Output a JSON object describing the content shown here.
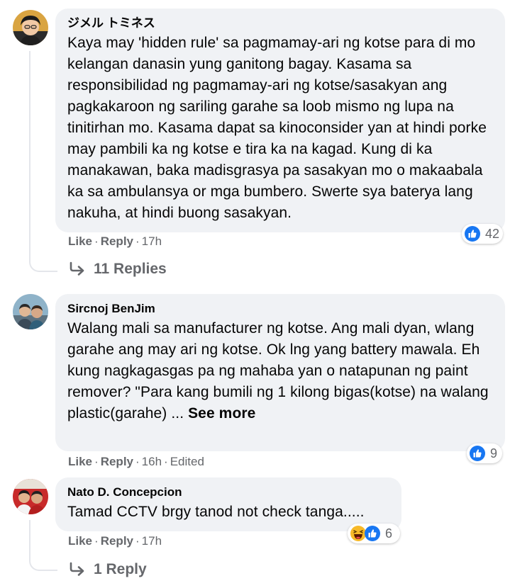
{
  "comments": [
    {
      "author": "ジメル トミネス",
      "text": "Kaya may 'hidden rule' sa pagmamay-ari ng kotse para di mo kelangan danasin yung ganitong bagay. Kasama sa responsibilidad ng pagmamay-ari ng kotse/sasakyan ang pagkakaroon ng sariling garahe sa loob mismo ng lupa na tinitirhan mo. Kasama dapat sa kinoconsider yan at hindi porke may pambili ka ng kotse e tira ka na kagad. Kung di ka manakawan, baka madisgrasya pa sasakyan mo o makaabala ka sa ambulansya or mga bumbero. Swerte sya baterya lang nakuha, at hindi buong sasakyan.",
      "like_label": "Like",
      "reply_label": "Reply",
      "time": "17h",
      "reaction_count": "42",
      "reaction_icons": [
        "like-icon"
      ],
      "replies_label": "11 Replies"
    },
    {
      "author": "Sircnoj BenJim",
      "text": "Walang mali sa manufacturer ng kotse. Ang mali dyan, wlang garahe ang may ari ng kotse. Ok lng yang battery mawala. Eh kung nagkagasgas pa ng mahaba yan o natapunan ng paint remover? \"Para kang bumili ng 1 kilong bigas(kotse) na walang plastic(garahe) ...",
      "see_more_label": "See more",
      "like_label": "Like",
      "reply_label": "Reply",
      "time": "16h",
      "edited_label": "Edited",
      "reaction_count": "9",
      "reaction_icons": [
        "like-icon"
      ]
    },
    {
      "author": "Nato D. Concepcion",
      "text": "Tamad CCTV brgy tanod not check tanga.....",
      "like_label": "Like",
      "reply_label": "Reply",
      "time": "17h",
      "reaction_count": "6",
      "reaction_icons": [
        "haha-icon",
        "like-icon"
      ],
      "replies_label": "1 Reply"
    }
  ],
  "colors": {
    "bubble": "#f0f2f5",
    "meta_text": "#65676b",
    "like_blue": "#1877f2",
    "thread_line": "#e4e6eb"
  },
  "separator": "·"
}
